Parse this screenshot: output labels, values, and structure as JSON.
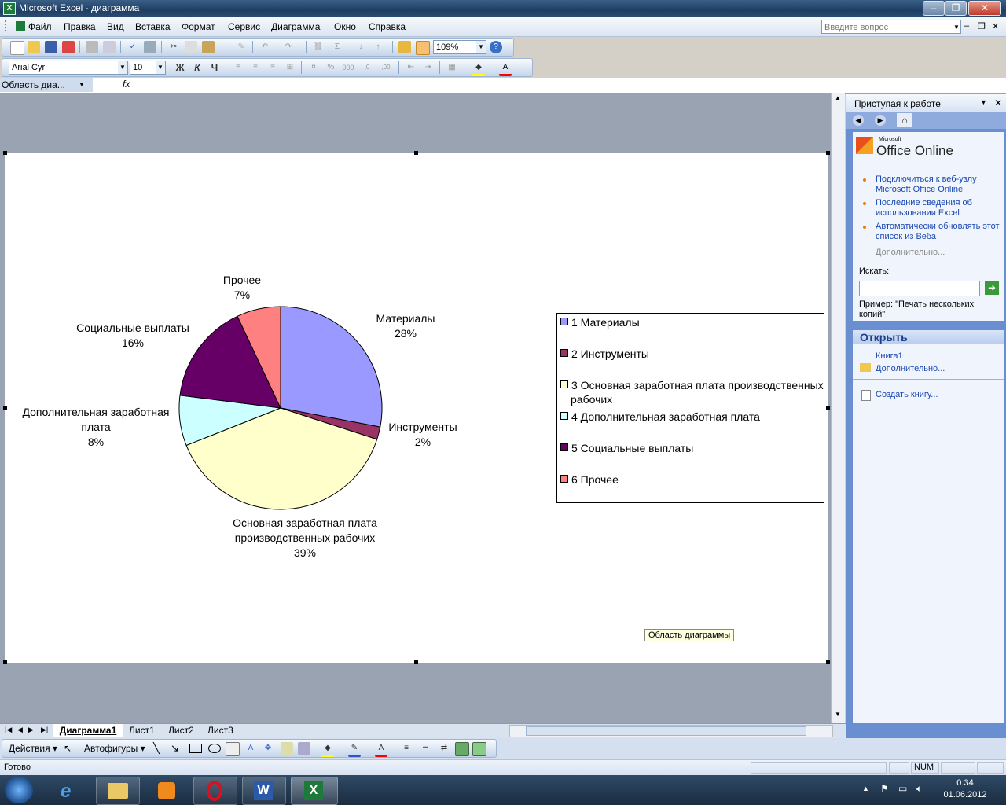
{
  "window": {
    "title": "Microsoft Excel - диаграмма",
    "app_icon": "excel-icon",
    "min_glyph": "–",
    "max_glyph": "❐",
    "close_glyph": "✕"
  },
  "menu": {
    "items": [
      "Файл",
      "Правка",
      "Вид",
      "Вставка",
      "Формат",
      "Сервис",
      "Диаграмма",
      "Окно",
      "Справка"
    ],
    "help_placeholder": "Введите вопрос",
    "doc_min": "–",
    "doc_max": "❐",
    "doc_close": "✕"
  },
  "toolbar": {
    "zoom": "109%",
    "font": "Arial Cyr",
    "size": "10",
    "bold": "Ж",
    "italic": "К",
    "underline": "Ч",
    "name_box": "Область диа...",
    "fx": "fx"
  },
  "chart_data": {
    "type": "pie",
    "categories": [
      "Материалы",
      "Инструменты",
      "Основная заработная плата производственных рабочих",
      "Дополнительная заработная плата",
      "Социальные выплаты",
      "Прочее"
    ],
    "values": [
      28,
      2,
      39,
      8,
      16,
      7
    ],
    "unit": "%",
    "colors": [
      "#9999ff",
      "#993366",
      "#ffffcc",
      "#ccffff",
      "#660066",
      "#ff8080"
    ],
    "labels": [
      {
        "name": "Материалы",
        "pct": "28%"
      },
      {
        "name": "Инструменты",
        "pct": "2%"
      },
      {
        "name": "Основная заработная плата",
        "name2": "производственных рабочих",
        "pct": "39%"
      },
      {
        "name": "Дополнительная заработная",
        "name2": "плата",
        "pct": "8%"
      },
      {
        "name": "Социальные выплаты",
        "pct": "16%"
      },
      {
        "name": "Прочее",
        "pct": "7%"
      }
    ],
    "legend": {
      "placement": "right",
      "entries": [
        "1 Материалы",
        "2 Инструменты",
        "3 Основная заработная плата производственных рабочих",
        "4 Дополнительная заработная плата",
        "5 Социальные выплаты",
        "6 Прочее"
      ],
      "entry3_line1": "3 Основная заработная плата производственных",
      "entry3_line2": "рабочих"
    }
  },
  "tooltip": "Область диаграммы",
  "sheet_tabs": [
    "Диаграмма1",
    "Лист1",
    "Лист2",
    "Лист3"
  ],
  "taskpane": {
    "title": "Приступая к работе",
    "brand": "Office Online",
    "brand_small": "Microsoft",
    "links": [
      "Подключиться к веб-узлу Microsoft Office Online",
      "Последние сведения об использовании Excel",
      "Автоматически обновлять этот список из Веба"
    ],
    "more": "Дополнительно...",
    "search_label": "Искать:",
    "example": "Пример:  \"Печать нескольких копий\"",
    "open_title": "Открыть",
    "recent": "Книга1",
    "open_more": "Дополнительно...",
    "create": "Создать книгу..."
  },
  "drawing": {
    "actions": "Действия ▾",
    "autoshapes": "Автофигуры ▾"
  },
  "status": {
    "ready": "Готово",
    "num": "NUM"
  },
  "taskbar": {
    "time": "0:34",
    "date": "01.06.2012"
  }
}
